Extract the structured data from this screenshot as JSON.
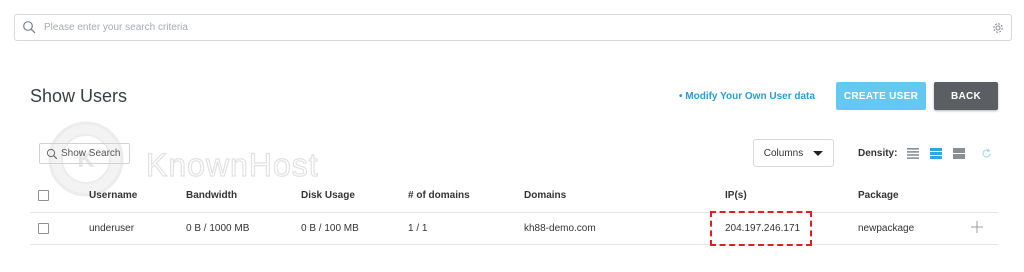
{
  "search": {
    "placeholder": "Please enter your search criteria"
  },
  "header": {
    "title": "Show Users",
    "modify_link": "• Modify Your Own User data",
    "create_user_label": "CREATE USER",
    "back_label": "BACK"
  },
  "watermark": {
    "brand": "KnownHost"
  },
  "toolbar": {
    "show_search_label": "Show Search",
    "columns_label": "Columns",
    "density_label": "Density:"
  },
  "table": {
    "headers": [
      "Username",
      "Bandwidth",
      "Disk Usage",
      "# of domains",
      "Domains",
      "IP(s)",
      "Package"
    ],
    "rows": [
      {
        "username": "underuser",
        "bandwidth": "0 B / 1000 MB",
        "disk_usage": "0 B / 100 MB",
        "domains_count": "1 / 1",
        "domains": "kh88-demo.com",
        "ips": "204.197.246.171",
        "package": "newpackage"
      }
    ]
  },
  "colors": {
    "accent_blue": "#2d9bd6",
    "create_button": "#63c9f3",
    "back_button": "#5b5f63",
    "highlight": "#e02020",
    "density_active": "#2fa6df"
  },
  "icons": {
    "search": "search-icon",
    "settings": "gear-icon",
    "density": [
      "density-compact-icon",
      "density-standard-icon",
      "density-comfortable-icon"
    ],
    "refresh": "refresh-icon",
    "expand": "plus-icon"
  }
}
